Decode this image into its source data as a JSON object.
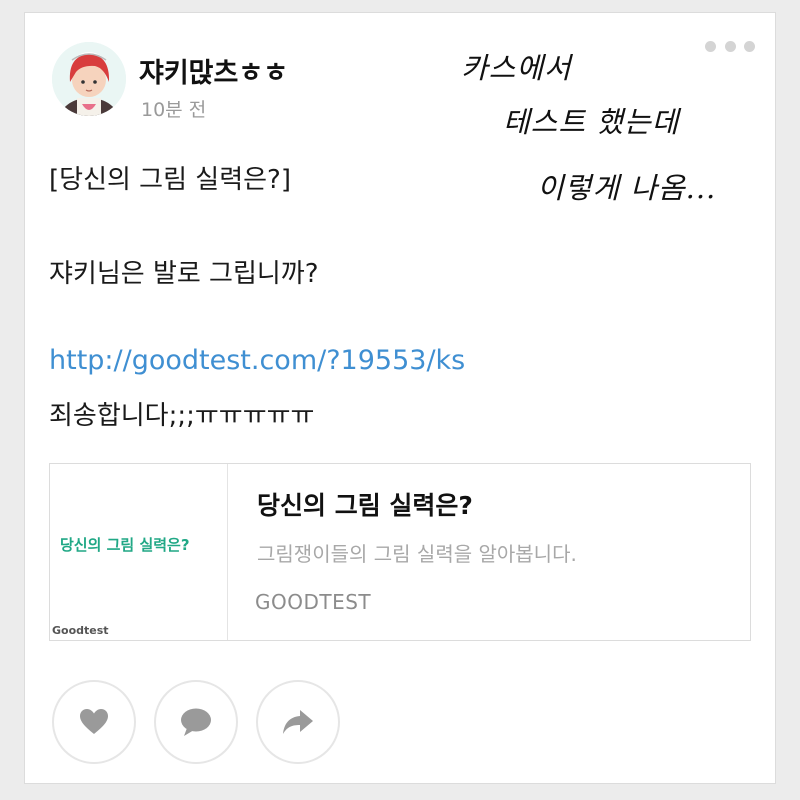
{
  "post": {
    "username": "쟈키맍츠ㅎㅎ",
    "timestamp": "10분 전",
    "more_icon": "more-dots-icon",
    "body_title": "[당신의 그림 실력은?]",
    "body_line2": "쟈키님은 발로 그립니까?",
    "link": "http://goodtest.com/?19553/ks",
    "body_line3": "죄송합니다;;;ㅠㅠㅠㅠㅠ"
  },
  "annotation": {
    "line1": "카스에서",
    "line2": "테스트 했는데",
    "line3": "이렇게 나옴..."
  },
  "link_preview": {
    "thumb_title": "당신의 그림 실력은?",
    "thumb_brand": "Goodtest",
    "title": "당신의 그림 실력은?",
    "description": "그림쟁이들의 그림 실력을 알아봅니다.",
    "domain": "GOODTEST",
    "accent_color": "#21a886"
  },
  "actions": {
    "like_icon": "heart-icon",
    "comment_icon": "comment-bubble-icon",
    "share_icon": "share-arrow-icon",
    "icon_color": "#9a9a9a"
  },
  "colors": {
    "link": "#3f8fd2",
    "background": "#ececec",
    "card": "#ffffff"
  }
}
